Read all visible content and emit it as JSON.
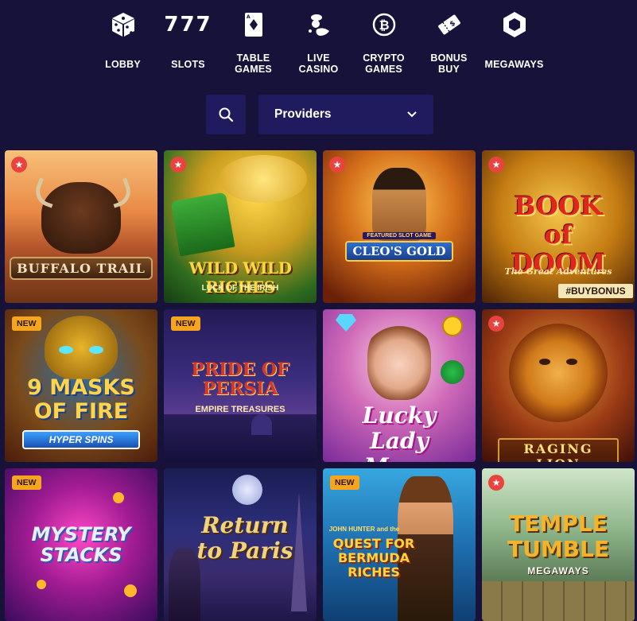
{
  "nav": {
    "items": [
      {
        "label": "LOBBY",
        "icon": "dice-icon"
      },
      {
        "label": "SLOTS",
        "icon": "777-icon",
        "icon_text": "777"
      },
      {
        "label": "TABLE GAMES",
        "icon": "playing-card-icon"
      },
      {
        "label": "LIVE CASINO",
        "icon": "live-dealer-icon"
      },
      {
        "label": "CRYPTO GAMES",
        "icon": "bitcoin-icon"
      },
      {
        "label": "BONUS BUY",
        "icon": "ticket-icon"
      },
      {
        "label": "MEGAWAYS",
        "icon": "hexagon-icon"
      }
    ]
  },
  "filter": {
    "providers_label": "Providers"
  },
  "games": [
    {
      "title": "BUFFALO TRAIL",
      "badge": "favorite"
    },
    {
      "title": "WILD WILD RICHES",
      "subtitle": "LUCK OF THE IRISH",
      "badge": "favorite"
    },
    {
      "title": "CLEO'S GOLD",
      "subtitle": "FEATURED SLOT GAME",
      "badge": "favorite"
    },
    {
      "title": "BOOK of DOOM",
      "subtitle": "The Great Adventures",
      "tag": "#BUYBONUS",
      "badge": "favorite"
    },
    {
      "title": "9 MASKS OF FIRE",
      "subtitle": "HYPER SPINS",
      "badge": "NEW"
    },
    {
      "title": "PRIDE OF PERSIA",
      "subtitle": "EMPIRE TREASURES",
      "badge": "NEW"
    },
    {
      "title": "Lucky Lady Moon",
      "badge": "none"
    },
    {
      "title": "RAGING LION",
      "badge": "favorite"
    },
    {
      "title": "MYSTERY STACKS",
      "badge": "NEW"
    },
    {
      "title": "Return to Paris",
      "badge": "none"
    },
    {
      "title": "QUEST FOR BERMUDA RICHES",
      "subtitle": "JOHN HUNTER and the",
      "badge": "NEW"
    },
    {
      "title": "TEMPLE TUMBLE",
      "subtitle": "MEGAWAYS",
      "badge": "favorite"
    }
  ],
  "badges": {
    "new_label": "NEW"
  },
  "colors": {
    "background": "#16123a",
    "control_bg": "#201a5e",
    "favorite_red": "#e8433e",
    "new_orange": "#f7a51c"
  }
}
